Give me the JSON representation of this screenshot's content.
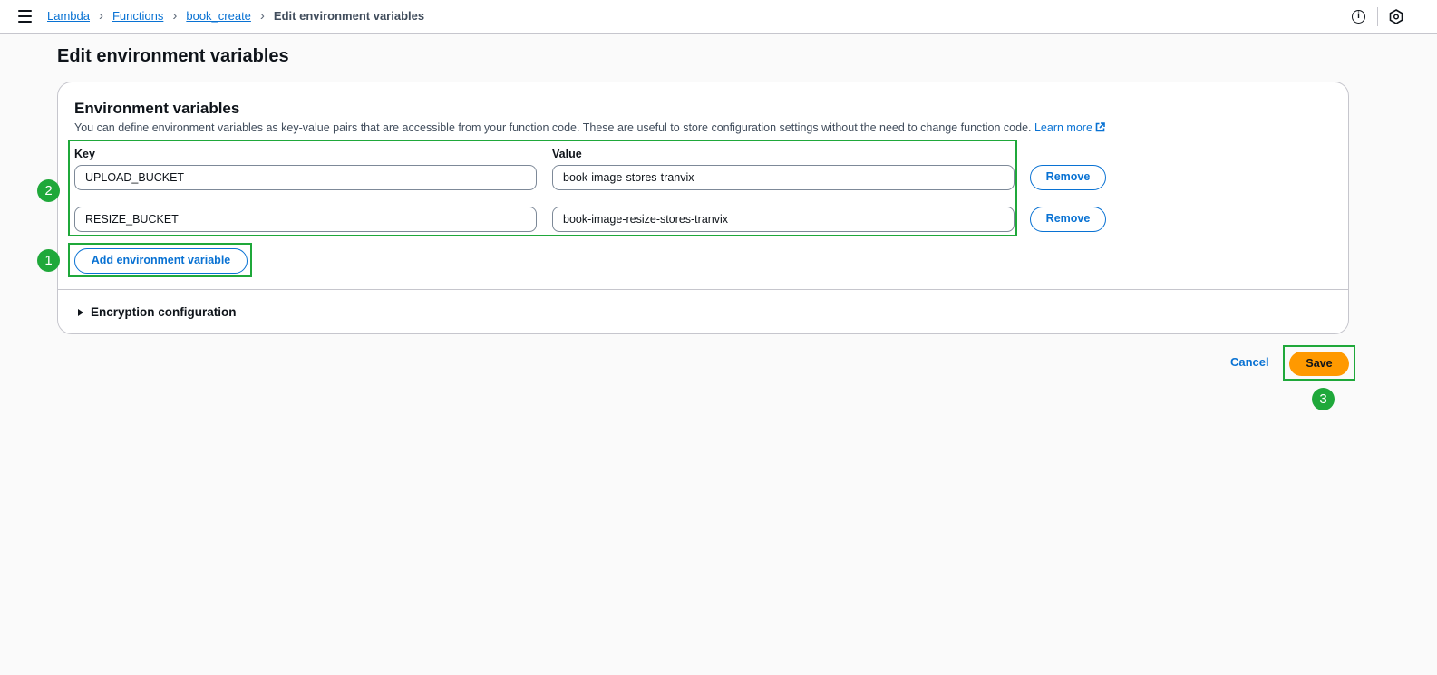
{
  "topbar": {
    "menu_icon": "hamburger-menu-icon",
    "breadcrumbs": [
      "Lambda",
      "Functions",
      "book_create",
      "Edit environment variables"
    ],
    "info_icon_glyph": "i",
    "profile_icon": "hexagon-icon"
  },
  "page": {
    "title": "Edit environment variables"
  },
  "env_section": {
    "heading": "Environment variables",
    "description": "You can define environment variables as key-value pairs that are accessible from your function code. These are useful to store configuration settings without the need to change function code.",
    "learn_more": "Learn more",
    "key_label": "Key",
    "value_label": "Value",
    "rows": [
      {
        "key": "UPLOAD_BUCKET",
        "value": "book-image-stores-tranvix",
        "remove_label": "Remove"
      },
      {
        "key": "RESIZE_BUCKET",
        "value": "book-image-resize-stores-tranvix",
        "remove_label": "Remove"
      }
    ],
    "add_label": "Add environment variable",
    "encryption_label": "Encryption configuration"
  },
  "actions": {
    "cancel_label": "Cancel",
    "save_label": "Save"
  },
  "annotations": {
    "badges": [
      "1",
      "2",
      "3"
    ],
    "color": "#1fa83a"
  },
  "colors": {
    "link": "#0972d3",
    "primary_button": "#ff9900",
    "highlight": "#1fa83a"
  }
}
